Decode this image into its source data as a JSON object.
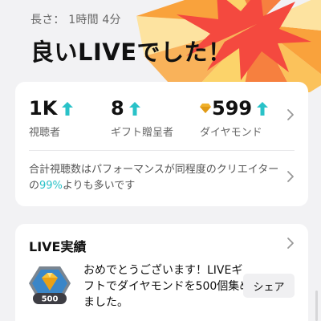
{
  "header": {
    "duration_label": "長さ：",
    "duration_value": "1時間 4分",
    "headline": "良いLIVEでした！"
  },
  "stats": {
    "items": [
      {
        "value": "1K",
        "label": "視聴者",
        "trend": "up"
      },
      {
        "value": "8",
        "label": "ギフト贈呈者",
        "trend": "up"
      },
      {
        "value": "599",
        "label": "ダイヤモンド",
        "trend": "up",
        "icon": "diamond-icon"
      }
    ],
    "comparison": {
      "prefix": "合計視聴数はパフォーマンスが同程度のクリエイターの",
      "percent": "99%",
      "suffix": "よりも多いです"
    }
  },
  "achievements": {
    "title": "LIVE実績",
    "badge_number": "500",
    "text": "おめでとうございます！LIVEギフトでダイヤモンドを500個集めました。",
    "share_label": "シェア"
  },
  "colors": {
    "accent_teal": "#29c2c8",
    "burst_red": "#f4493f",
    "burst_orange": "#f9a23c",
    "burst_yellow": "#fcd36a",
    "diamond_gold": "#f0b12b"
  }
}
